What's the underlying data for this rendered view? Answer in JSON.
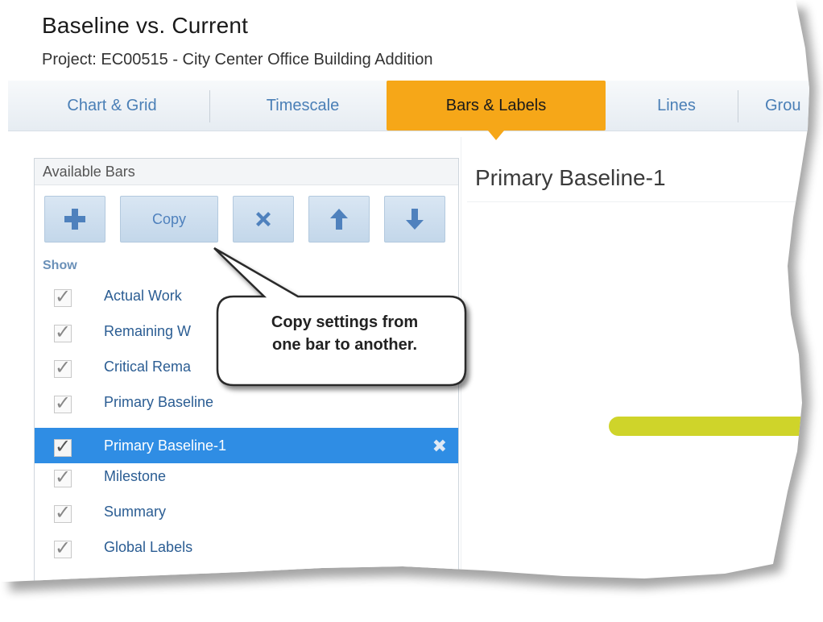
{
  "header": {
    "title": "Baseline vs. Current",
    "project": "Project: EC00515 - City Center Office Building Addition"
  },
  "tabs": [
    {
      "label": "Chart & Grid"
    },
    {
      "label": "Timescale"
    },
    {
      "label": "Bars & Labels"
    },
    {
      "label": "Lines"
    },
    {
      "label": "Grou"
    }
  ],
  "left_panel": {
    "header": "Available Bars",
    "toolbar": {
      "add_icon": "plus-icon",
      "copy_label": "Copy",
      "delete_icon": "x-icon",
      "up_icon": "arrow-up-icon",
      "down_icon": "arrow-down-icon"
    },
    "show_label": "Show",
    "bars": [
      {
        "label": "Actual Work",
        "checked": true
      },
      {
        "label": "Remaining W",
        "checked": true
      },
      {
        "label": "Critical Rema",
        "checked": true
      },
      {
        "label": "Primary Baseline",
        "checked": true
      },
      {
        "label": "Primary Baseline-1",
        "checked": true,
        "selected": true
      },
      {
        "label": "Milestone",
        "checked": true
      },
      {
        "label": "Summary",
        "checked": true
      },
      {
        "label": "Global Labels",
        "checked": true
      }
    ]
  },
  "right_panel": {
    "title": "Primary Baseline-1"
  },
  "callout": {
    "line1": "Copy settings from",
    "line2": "one bar to another."
  },
  "colors": {
    "active_tab": "#f6a718",
    "selected_row": "#2f8de4",
    "baseline_bar": "#cfd42a",
    "tab_text": "#4a7fb6"
  }
}
